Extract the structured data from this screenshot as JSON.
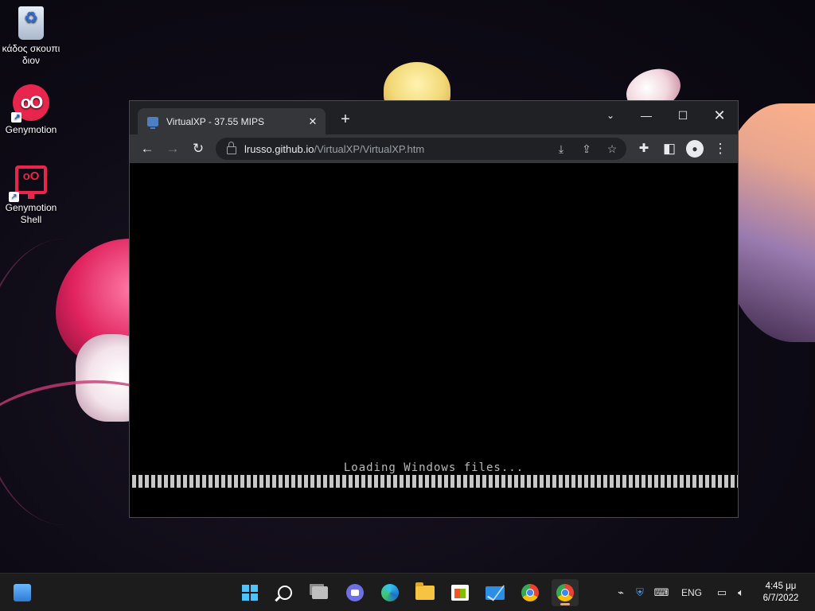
{
  "desktop": {
    "icons": [
      {
        "label": "κάδος σκουπι διον"
      },
      {
        "label": "Genymotion"
      },
      {
        "label": "Genymotion Shell"
      }
    ]
  },
  "browser": {
    "tab": {
      "title": "VirtualXP - 37.55 MIPS",
      "close": "✕"
    },
    "new_tab": "+",
    "window_controls": {
      "tab_search": "⌄",
      "minimize": "—",
      "maximize": "☐",
      "close": "✕"
    },
    "nav": {
      "back": "←",
      "forward": "→",
      "reload": "↻"
    },
    "address": {
      "host": "lrusso.github.io",
      "path": "/VirtualXP/VirtualXP.htm"
    },
    "toolbar_icons": {
      "install": "⤓",
      "share": "⇪",
      "bookmark": "☆",
      "extensions": "✚",
      "side_panel": "◧",
      "profile": "●",
      "menu": "⋮"
    },
    "page": {
      "loading_text": "Loading Windows files...",
      "progress": 1.0
    }
  },
  "taskbar": {
    "apps": [
      "widgets",
      "start",
      "search",
      "task-view",
      "teams-chat",
      "edge",
      "file-explorer",
      "microsoft-store",
      "mail",
      "chrome",
      "chrome-profile"
    ],
    "tray": {
      "language": "ENG"
    },
    "clock": {
      "time": "4:45 μμ",
      "date": "6/7/2022"
    }
  },
  "colors": {
    "accent_pink": "#e8264d",
    "chrome_dark": "#202124",
    "chrome_toolbar": "#35363a",
    "taskbar": "#1c1c1c"
  }
}
